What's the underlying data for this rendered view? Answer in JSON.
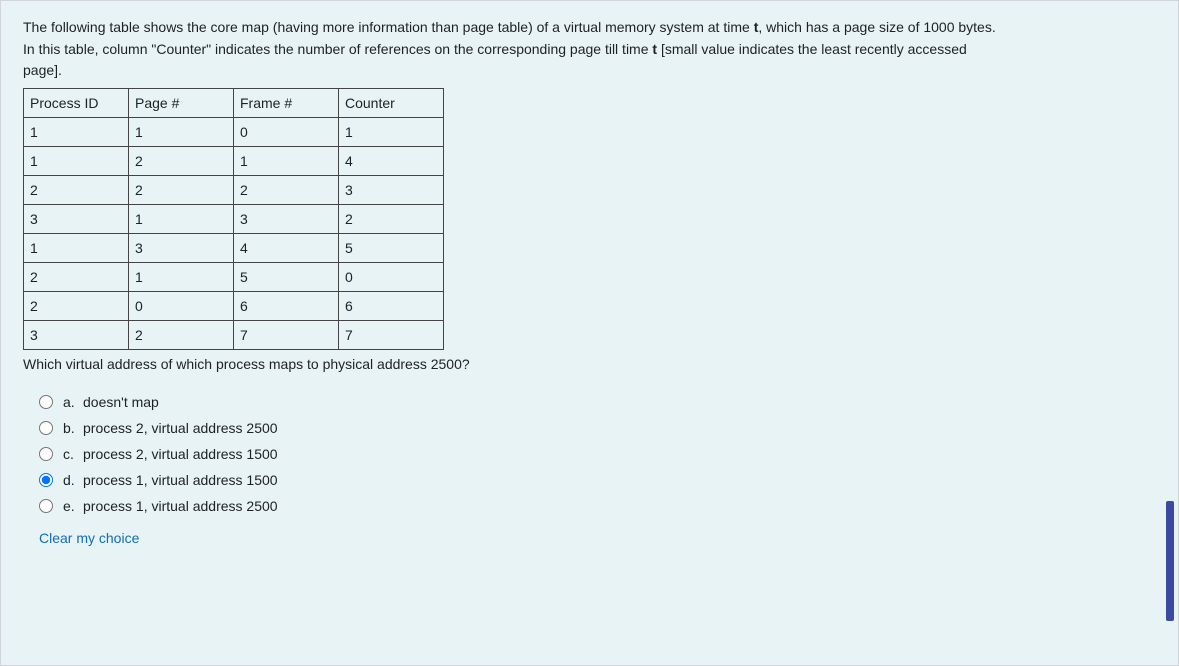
{
  "intro": {
    "line1a": "The following table shows the core map (having more information than page table) of a virtual memory system at time ",
    "line1_bold1": "t",
    "line1b": ", which has a page size of 1000 bytes.",
    "line2a": "In this table, column \"Counter\" indicates the number of references on the corresponding page till time ",
    "line2_bold1": "t",
    "line2b": " [small value indicates the least recently accessed",
    "line3": "page]."
  },
  "table": {
    "headers": [
      "Process ID",
      "Page #",
      "Frame #",
      "Counter"
    ],
    "rows": [
      [
        "1",
        "1",
        "0",
        "1"
      ],
      [
        "1",
        "2",
        "1",
        "4"
      ],
      [
        "2",
        "2",
        "2",
        "3"
      ],
      [
        "3",
        "1",
        "3",
        "2"
      ],
      [
        "1",
        "3",
        "4",
        "5"
      ],
      [
        "2",
        "1",
        "5",
        "0"
      ],
      [
        "2",
        "0",
        "6",
        "6"
      ],
      [
        "3",
        "2",
        "7",
        "7"
      ]
    ]
  },
  "question2": "Which virtual address of which process maps to physical address 2500?",
  "options": [
    {
      "letter": "a.",
      "text": "doesn't map",
      "selected": false
    },
    {
      "letter": "b.",
      "text": "process 2, virtual address 2500",
      "selected": false
    },
    {
      "letter": "c.",
      "text": "process 2, virtual address 1500",
      "selected": false
    },
    {
      "letter": "d.",
      "text": "process 1, virtual address 1500",
      "selected": true
    },
    {
      "letter": "e.",
      "text": "process 1, virtual address 2500",
      "selected": false
    }
  ],
  "clear": "Clear my choice"
}
